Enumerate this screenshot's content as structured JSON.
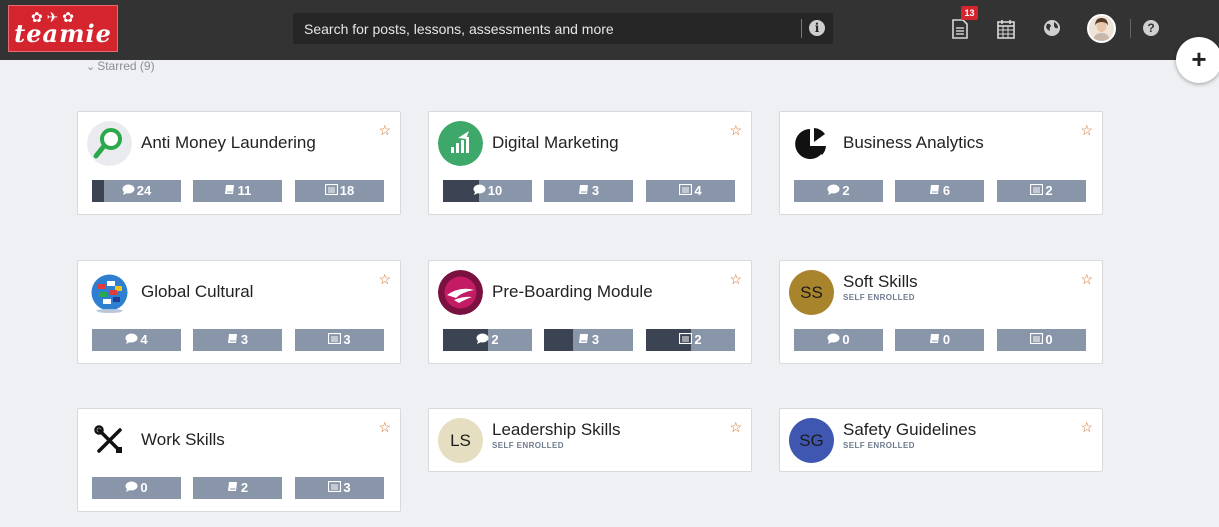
{
  "header": {
    "logo_text": "teamie",
    "search_placeholder": "Search for posts, lessons, assessments and more",
    "notification_count": "13",
    "info_glyph": "i",
    "help_glyph": "?",
    "fab_glyph": "+",
    "icons": [
      "notes-icon",
      "calendar-icon",
      "globe-icon",
      "user-avatar",
      "help-icon"
    ]
  },
  "section": {
    "label": "Starred (9)"
  },
  "colors": {
    "topbar": "#333333",
    "brand_red": "#d4242e",
    "stat_bg": "#8995a9",
    "stat_fill": "#3c4453",
    "star": "#d2691e"
  },
  "cards": [
    {
      "title": "Anti Money Laundering",
      "subtitle": "",
      "icon": "magnifier-icon",
      "stats": [
        {
          "label": "24",
          "icon": "comment-icon",
          "progress": 0.13
        },
        {
          "label": "11",
          "icon": "book-icon",
          "progress": 0
        },
        {
          "label": "18",
          "icon": "list-icon",
          "progress": 0
        }
      ]
    },
    {
      "title": "Digital Marketing",
      "subtitle": "",
      "icon": "rocket-chart-icon",
      "stats": [
        {
          "label": "10",
          "icon": "comment-icon",
          "progress": 0.4
        },
        {
          "label": "3",
          "icon": "book-icon",
          "progress": 0
        },
        {
          "label": "4",
          "icon": "list-icon",
          "progress": 0
        }
      ]
    },
    {
      "title": "Business Analytics",
      "subtitle": "",
      "icon": "pie-chart-icon",
      "stats": [
        {
          "label": "2",
          "icon": "comment-icon",
          "progress": 0
        },
        {
          "label": "6",
          "icon": "book-icon",
          "progress": 0
        },
        {
          "label": "2",
          "icon": "list-icon",
          "progress": 0
        }
      ]
    },
    {
      "title": "Global Cultural",
      "subtitle": "",
      "icon": "globe-flags-icon",
      "stats": [
        {
          "label": "4",
          "icon": "comment-icon",
          "progress": 0
        },
        {
          "label": "3",
          "icon": "book-icon",
          "progress": 0
        },
        {
          "label": "3",
          "icon": "list-icon",
          "progress": 0
        }
      ]
    },
    {
      "title": "Pre-Boarding Module",
      "subtitle": "",
      "icon": "airline-logo-icon",
      "stats": [
        {
          "label": "2",
          "icon": "comment-icon",
          "progress": 0.5
        },
        {
          "label": "3",
          "icon": "book-icon",
          "progress": 0.33
        },
        {
          "label": "2",
          "icon": "list-icon",
          "progress": 0.5
        }
      ]
    },
    {
      "title": "Soft Skills",
      "subtitle": "SELF ENROLLED",
      "initials": "SS",
      "avatar_color": "#a8842c",
      "stats": [
        {
          "label": "0",
          "icon": "comment-icon",
          "progress": 0
        },
        {
          "label": "0",
          "icon": "book-icon",
          "progress": 0
        },
        {
          "label": "0",
          "icon": "list-icon",
          "progress": 0
        }
      ]
    },
    {
      "title": "Work Skills",
      "subtitle": "",
      "icon": "tools-icon",
      "stats": [
        {
          "label": "0",
          "icon": "comment-icon",
          "progress": 0
        },
        {
          "label": "2",
          "icon": "book-icon",
          "progress": 0
        },
        {
          "label": "3",
          "icon": "list-icon",
          "progress": 0
        }
      ]
    },
    {
      "title": "Leadership Skills",
      "subtitle": "SELF ENROLLED",
      "initials": "LS",
      "avatar_color": "#e6dec0",
      "stats": []
    },
    {
      "title": "Safety Guidelines",
      "subtitle": "SELF ENROLLED",
      "initials": "SG",
      "avatar_color": "#3f57b0",
      "stats": []
    }
  ]
}
